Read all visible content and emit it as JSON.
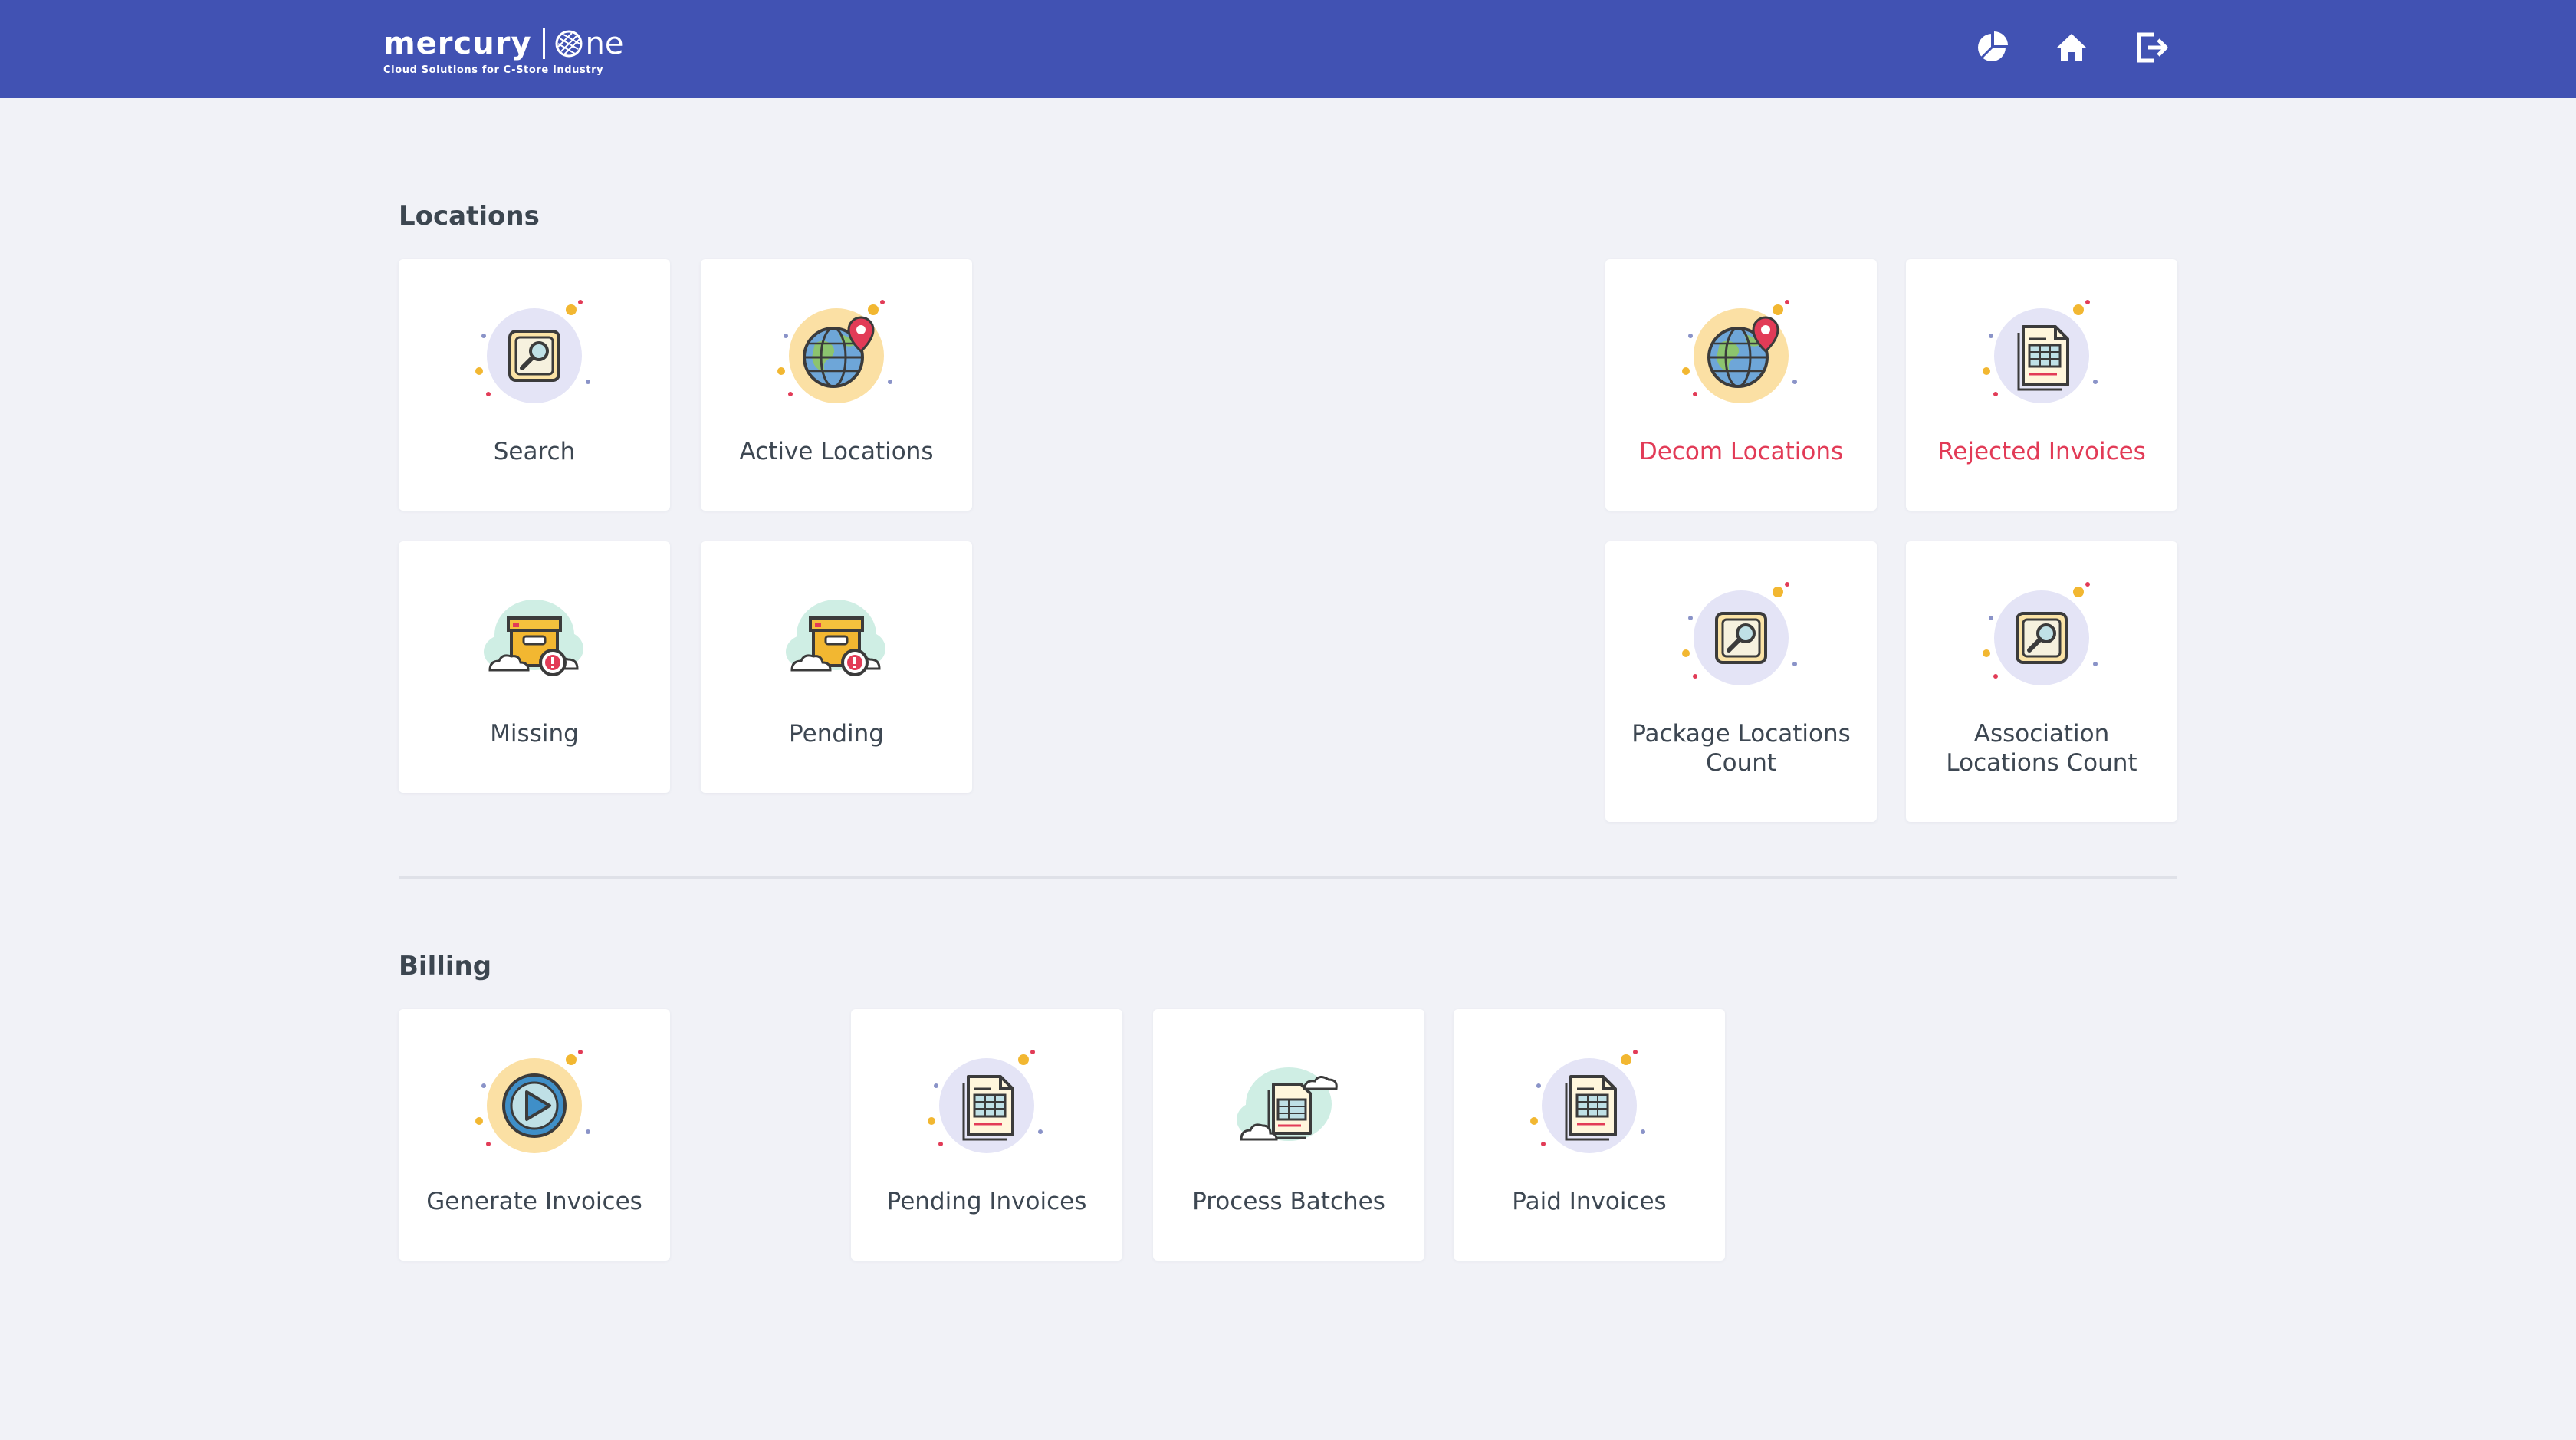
{
  "header": {
    "logo_word": "mercury",
    "logo_one": "ne",
    "logo_tagline": "Cloud Solutions for C-Store Industry",
    "icons": [
      "dashboard-pie-icon",
      "home-icon",
      "logout-icon"
    ],
    "bg_color": "#4152b3"
  },
  "locations": {
    "title": "Locations",
    "tiles": {
      "search": "Search",
      "active": "Active Locations",
      "decom": "Decom Locations",
      "rejected": "Rejected Invoices",
      "missing": "Missing",
      "pending": "Pending",
      "package_line1": "Package Locations",
      "package_line2": "Count",
      "association_line1": "Association",
      "association_line2": "Locations Count"
    }
  },
  "billing": {
    "title": "Billing",
    "tiles": {
      "generate": "Generate Invoices",
      "pending_invoices": "Pending Invoices",
      "process_batches": "Process Batches",
      "paid_invoices": "Paid Invoices"
    }
  },
  "colors": {
    "accent_red": "#e23b57",
    "page_bg": "#f1f2f7",
    "text": "#3d4752"
  }
}
